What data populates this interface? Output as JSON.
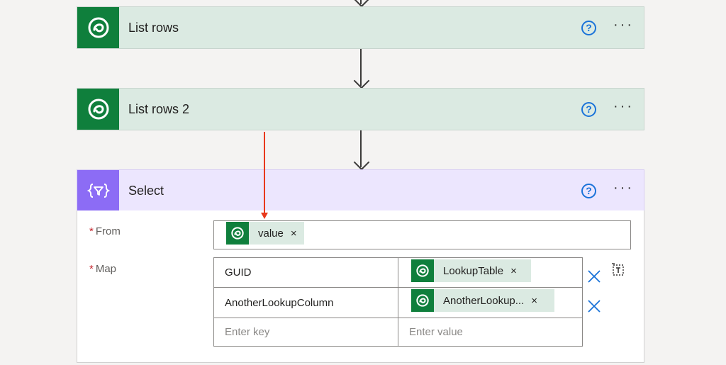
{
  "steps": [
    {
      "title": "List rows",
      "icon": "dataverse-icon"
    },
    {
      "title": "List rows 2",
      "icon": "dataverse-icon"
    },
    {
      "title": "Select",
      "icon": "data-operation-icon"
    }
  ],
  "help_glyph": "?",
  "more_glyph": "···",
  "select": {
    "from_label": "From",
    "map_label": "Map",
    "required_mark": "*",
    "from_token": "value",
    "token_remove": "×",
    "rows": [
      {
        "key": "GUID",
        "value_token": "LookupTable"
      },
      {
        "key": "AnotherLookupColumn",
        "value_token": "AnotherLookup..."
      }
    ],
    "key_placeholder": "Enter key",
    "value_placeholder": "Enter value"
  },
  "colors": {
    "dataverse_green": "#0f7f3c",
    "header_green": "#dbeae2",
    "select_purple": "#8c6cf5",
    "select_header": "#ece6fe",
    "link_blue": "#1a73d9",
    "annotation_red": "#e8381c"
  }
}
